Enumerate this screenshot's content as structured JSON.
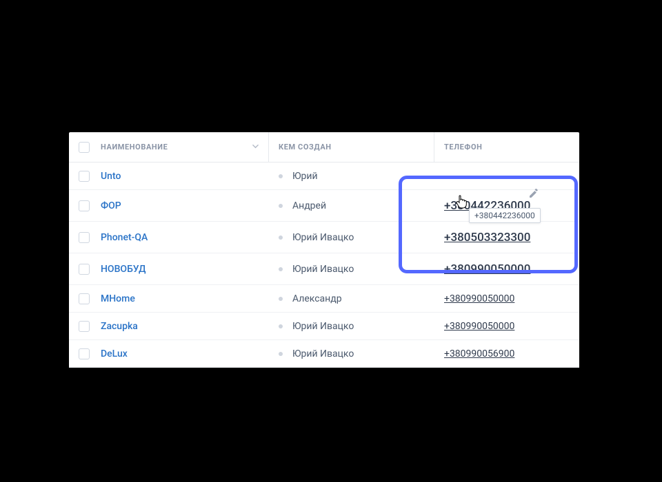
{
  "columns": {
    "name": "НАИМЕНОВАНИЕ",
    "created_by": "КЕМ СОЗДАН",
    "phone": "ТЕЛЕФОН"
  },
  "rows": [
    {
      "name": "Unto",
      "creator": "Юрий",
      "phone": ""
    },
    {
      "name": "ФОР",
      "creator": "Андрей",
      "phone": "+380442236000"
    },
    {
      "name": "Phonet-QA",
      "creator": "Юрий Ивацко",
      "phone": "+380503323300"
    },
    {
      "name": "НОВОБУД",
      "creator": "Юрий Ивацко",
      "phone": "+380990050000"
    },
    {
      "name": "MHome",
      "creator": "Александр",
      "phone": "+380990050000"
    },
    {
      "name": "Zacupka",
      "creator": "Юрий Ивацко",
      "phone": "+380990050000"
    },
    {
      "name": "DeLux",
      "creator": "Юрий Ивацко",
      "phone": "+380990056900"
    }
  ],
  "tooltip": "+380442236000"
}
